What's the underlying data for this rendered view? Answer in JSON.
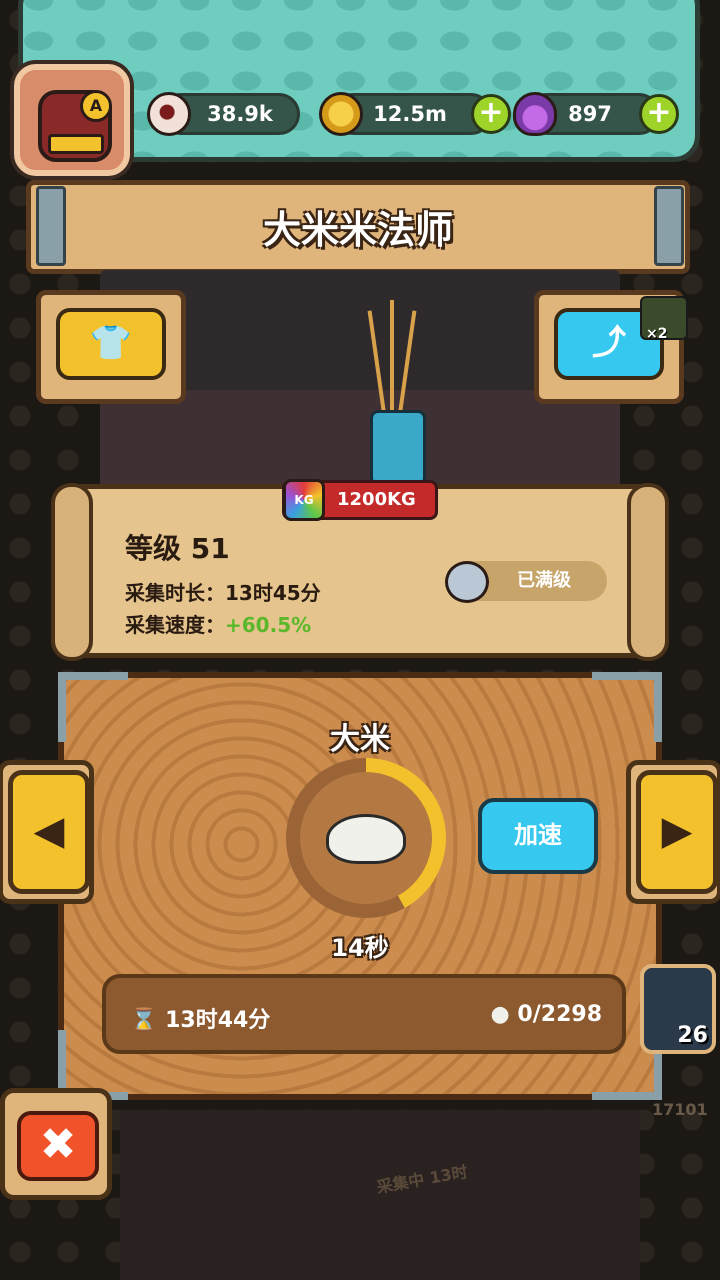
{
  "resources": {
    "eyeballs": "38.9k",
    "coins": "12.5m",
    "potions": "897",
    "plus_symbol": "+"
  },
  "avatar": {
    "badge_letter": "A"
  },
  "header": {
    "title": "大米米法师"
  },
  "buttons": {
    "wardrobe_icon": "👕",
    "share_icon": "⤴",
    "share_multiplier": "×2"
  },
  "character": {
    "weight": "1200KG",
    "weight_icon_text": "KG"
  },
  "stats": {
    "level": "等级 51",
    "duration_label": "采集时长：",
    "duration_value": "13时45分",
    "speed_label": "采集速度：",
    "speed_value": "+60.5%",
    "max_level": "已满级"
  },
  "harvest": {
    "crop_name": "大米",
    "progress": 0.42,
    "remaining": "14秒",
    "speed_up": "加速",
    "total_time": "13时44分",
    "count": "0/2298"
  },
  "nav": {
    "prev": "◀",
    "next": "▶",
    "close": "✖"
  },
  "side_badge": {
    "count": "26"
  },
  "background": {
    "id_text": "17101",
    "collecting": "采集中",
    "collect_time": "13时"
  },
  "colors": {
    "panel_teal": "#6fcdc0",
    "wood": "#e0b57c",
    "accent_yellow": "#f3c12c",
    "accent_blue": "#36c8ee",
    "accent_green": "#9ed42a",
    "close_red": "#f0522a",
    "weight_red": "#c52a2a"
  }
}
